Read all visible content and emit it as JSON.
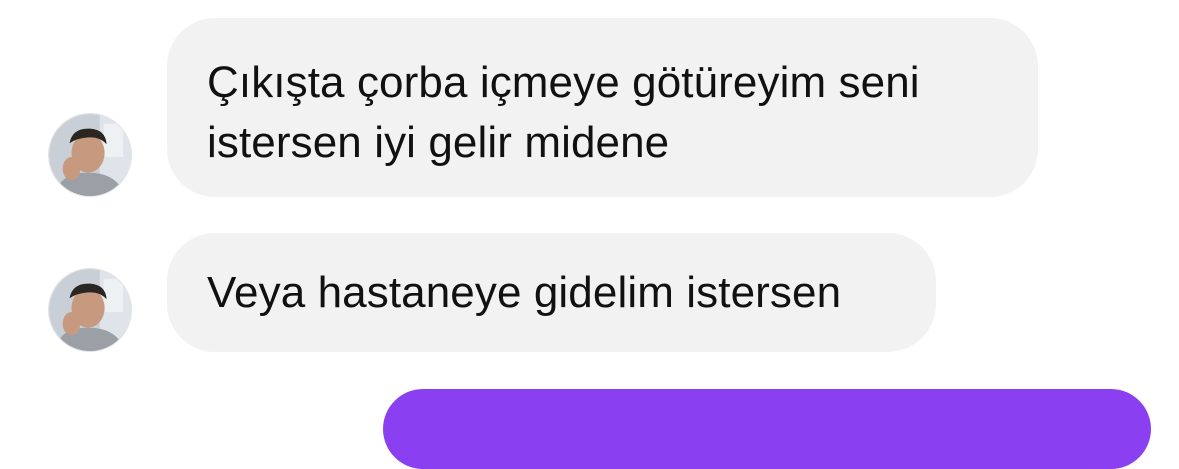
{
  "thread": {
    "messages": [
      {
        "direction": "incoming",
        "lines": [
          "Çıkışta çorba içmeye götüreyim seni",
          "istersen iyi gelir midene"
        ]
      },
      {
        "direction": "incoming",
        "lines": [
          "Veya hastaneye gidelim istersen"
        ]
      },
      {
        "direction": "outgoing",
        "lines": []
      }
    ]
  },
  "colors": {
    "incoming_bubble": "#f2f2f3",
    "outgoing_bubble": "#8a3ff0",
    "text": "#111111"
  }
}
